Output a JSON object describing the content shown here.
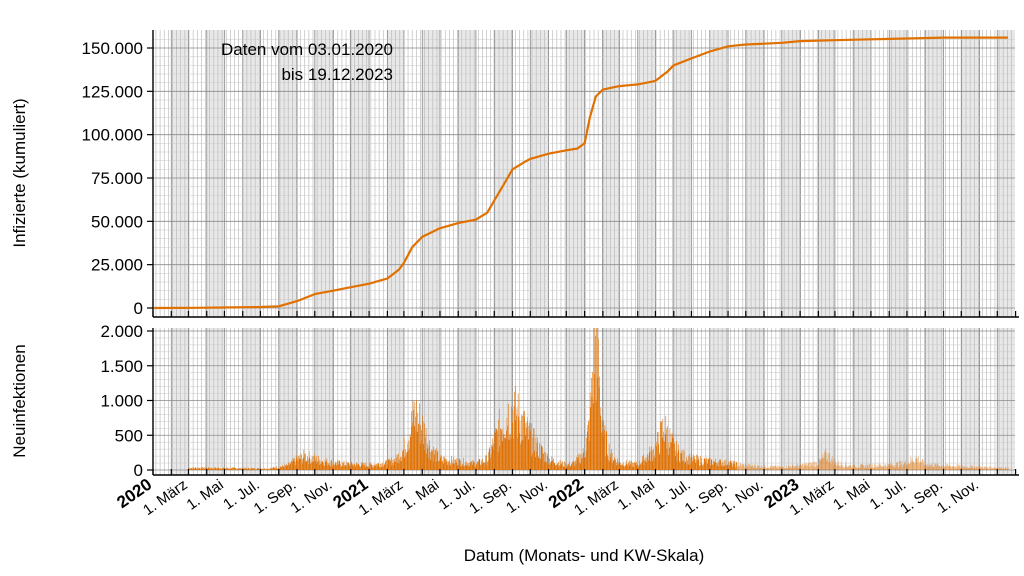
{
  "chart_data": [
    {
      "type": "line",
      "ylabel": "Infizierte (kumuliert)",
      "ylim": [
        0,
        160000
      ],
      "yticks": [
        0,
        25000,
        50000,
        75000,
        100000,
        125000,
        150000
      ],
      "ytick_labels": [
        "0",
        "25.000",
        "50.000",
        "75.000",
        "100.000",
        "125.000",
        "150.000"
      ],
      "annotation": [
        "Daten vom 03.01.2020",
        "bis 19.12.2023"
      ],
      "color": "#e07000",
      "x": [
        "2020-01-03",
        "2020-03-15",
        "2020-05-01",
        "2020-07-01",
        "2020-08-01",
        "2020-09-01",
        "2020-10-01",
        "2020-11-01",
        "2020-12-01",
        "2021-01-01",
        "2021-02-01",
        "2021-02-20",
        "2021-03-01",
        "2021-03-15",
        "2021-04-01",
        "2021-05-01",
        "2021-06-01",
        "2021-07-01",
        "2021-07-20",
        "2021-08-01",
        "2021-08-20",
        "2021-09-01",
        "2021-09-20",
        "2021-10-01",
        "2021-11-01",
        "2021-12-01",
        "2021-12-20",
        "2022-01-01",
        "2022-01-10",
        "2022-01-20",
        "2022-02-01",
        "2022-03-01",
        "2022-04-01",
        "2022-05-01",
        "2022-05-20",
        "2022-06-01",
        "2022-07-01",
        "2022-08-01",
        "2022-09-01",
        "2022-10-01",
        "2022-11-01",
        "2022-12-01",
        "2023-01-01",
        "2023-03-01",
        "2023-05-01",
        "2023-07-01",
        "2023-09-01",
        "2023-11-01",
        "2023-12-19"
      ],
      "y": [
        0,
        100,
        300,
        600,
        1000,
        4000,
        8000,
        10000,
        12000,
        14000,
        17000,
        22000,
        26000,
        35000,
        41000,
        46000,
        49000,
        51000,
        55000,
        62000,
        73000,
        80000,
        84000,
        86000,
        89000,
        91000,
        92000,
        95000,
        110000,
        122000,
        126000,
        128000,
        129000,
        131000,
        136000,
        140000,
        144000,
        148000,
        151000,
        152000,
        152500,
        153000,
        154000,
        154500,
        155000,
        155500,
        156000,
        156000,
        156000
      ]
    },
    {
      "type": "bar",
      "ylabel": "Neuinfektionen",
      "ylim": [
        0,
        2000
      ],
      "yticks": [
        0,
        500,
        1000,
        1500,
        2000
      ],
      "ytick_labels": [
        "0",
        "500",
        "1.000",
        "1.500",
        "2.000"
      ],
      "color": "#e07000",
      "x": [
        "2020-03-15",
        "2020-07-15",
        "2020-08-15",
        "2020-09-01",
        "2020-09-15",
        "2020-10-01",
        "2020-11-01",
        "2020-12-01",
        "2021-01-01",
        "2021-02-01",
        "2021-02-15",
        "2021-03-01",
        "2021-03-10",
        "2021-03-20",
        "2021-04-01",
        "2021-04-15",
        "2021-05-01",
        "2021-06-01",
        "2021-07-01",
        "2021-07-20",
        "2021-08-01",
        "2021-08-15",
        "2021-09-01",
        "2021-09-15",
        "2021-10-01",
        "2021-10-15",
        "2021-11-01",
        "2021-12-01",
        "2021-12-15",
        "2022-01-01",
        "2022-01-08",
        "2022-01-12",
        "2022-01-18",
        "2022-01-25",
        "2022-02-01",
        "2022-02-15",
        "2022-03-01",
        "2022-04-01",
        "2022-05-01",
        "2022-05-15",
        "2022-06-01",
        "2022-06-15",
        "2022-07-01",
        "2022-08-01",
        "2022-09-01",
        "2022-10-01",
        "2022-11-01",
        "2022-12-01",
        "2023-01-01",
        "2023-02-01",
        "2023-02-15",
        "2023-03-01",
        "2023-04-01",
        "2023-05-01",
        "2023-06-01",
        "2023-07-01",
        "2023-07-15",
        "2023-08-01",
        "2023-09-01",
        "2023-10-01",
        "2023-11-01",
        "2023-12-19"
      ],
      "values": [
        30,
        20,
        60,
        150,
        200,
        150,
        100,
        80,
        70,
        100,
        150,
        300,
        550,
        800,
        600,
        300,
        150,
        120,
        90,
        150,
        400,
        700,
        850,
        700,
        450,
        300,
        150,
        70,
        100,
        250,
        600,
        1000,
        1950,
        1300,
        500,
        200,
        100,
        80,
        300,
        600,
        300,
        200,
        150,
        120,
        100,
        60,
        50,
        40,
        60,
        100,
        220,
        100,
        50,
        60,
        70,
        100,
        170,
        80,
        60,
        50,
        40,
        30
      ]
    }
  ],
  "x_axis": {
    "title": "Datum (Monats- und KW-Skala)",
    "start": "2020-01-01",
    "end": "2023-12-31",
    "month_labels": [
      {
        "date": "2020-01-01",
        "text": "2020",
        "year": true
      },
      {
        "date": "2020-03-01",
        "text": "1. März"
      },
      {
        "date": "2020-05-01",
        "text": "1. Mai"
      },
      {
        "date": "2020-07-01",
        "text": "1. Jul."
      },
      {
        "date": "2020-09-01",
        "text": "1. Sep."
      },
      {
        "date": "2020-11-01",
        "text": "1. Nov."
      },
      {
        "date": "2021-01-01",
        "text": "2021",
        "year": true
      },
      {
        "date": "2021-03-01",
        "text": "1. März"
      },
      {
        "date": "2021-05-01",
        "text": "1. Mai"
      },
      {
        "date": "2021-07-01",
        "text": "1. Jul."
      },
      {
        "date": "2021-09-01",
        "text": "1. Sep."
      },
      {
        "date": "2021-11-01",
        "text": "1. Nov."
      },
      {
        "date": "2022-01-01",
        "text": "2022",
        "year": true
      },
      {
        "date": "2022-03-01",
        "text": "1. März"
      },
      {
        "date": "2022-05-01",
        "text": "1. Mai"
      },
      {
        "date": "2022-07-01",
        "text": "1. Jul."
      },
      {
        "date": "2022-09-01",
        "text": "1. Sep."
      },
      {
        "date": "2022-11-01",
        "text": "1. Nov."
      },
      {
        "date": "2023-01-01",
        "text": "2023",
        "year": true
      },
      {
        "date": "2023-03-01",
        "text": "1. März"
      },
      {
        "date": "2023-05-01",
        "text": "1. Mai"
      },
      {
        "date": "2023-07-01",
        "text": "1. Jul."
      },
      {
        "date": "2023-09-01",
        "text": "1. Sep."
      },
      {
        "date": "2023-11-01",
        "text": "1. Nov."
      }
    ],
    "grid": true,
    "alternating_month_shading": true
  }
}
